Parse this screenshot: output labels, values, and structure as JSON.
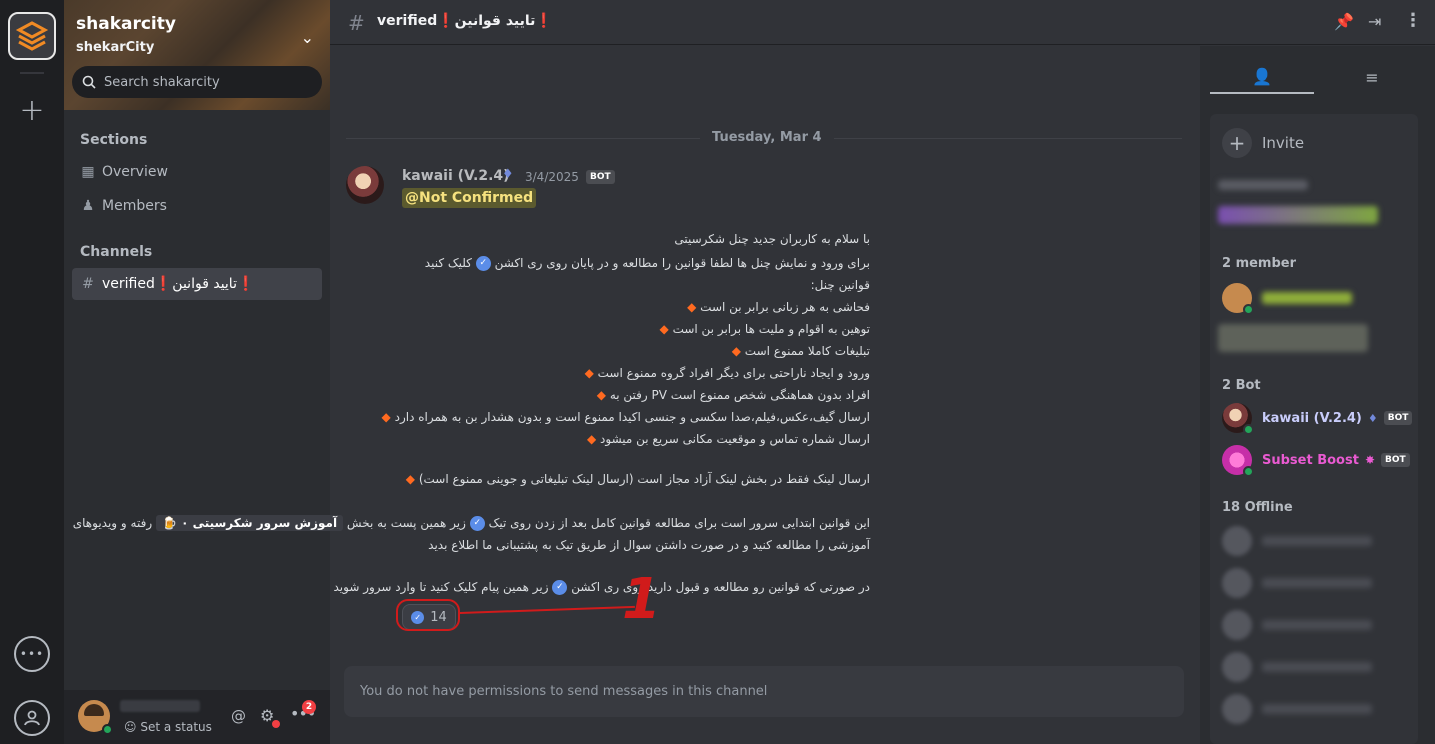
{
  "app": {
    "server_name": "shakarcity",
    "server_subtitle": "shekarCity",
    "search_placeholder": "Search shakarcity"
  },
  "sidebar": {
    "sections_header": "Sections",
    "sections": [
      {
        "label": "Overview",
        "icon": "grid-icon"
      },
      {
        "label": "Members",
        "icon": "members-icon"
      }
    ],
    "channels_header": "Channels",
    "channels": [
      {
        "label": "verified❗تایید قوانین❗",
        "icon": "hash-icon",
        "selected": true
      }
    ]
  },
  "user_panel": {
    "set_status": "Set a status",
    "notification_count": "2"
  },
  "header": {
    "channel_title": "verified❗تایید قوانین❗"
  },
  "chat": {
    "date_divider": "Tuesday, Mar 4",
    "message": {
      "author": "kawaii (V.2.4)",
      "date": "3/4/2025",
      "bot_tag": "BOT",
      "mention": "@Not Confirmed",
      "lines": [
        "با سلام به کاربران جدید چنل شکرسیتی",
        "برای ورود و نمایش چنل ها لطفا قوانین را مطالعه و در پایان روی ری اکشن",
        "کلیک کنید",
        "قوانین چنل:",
        "فحاشی به هر زبانی برابر بن است",
        "توهین به اقوام و ملیت ها برابر بن است",
        "تبلیغات کاملا ممنوع است",
        "ورود و ایجاد ناراحتی برای دیگر افراد گروه ممنوع است",
        "افراد بدون هماهنگی شخص ممنوع است PV رفتن به",
        "ارسال گیف،عکس،فیلم،صدا سکسی و جنسی اکیدا ممنوع است و بدون هشدار بن به همراه دارد",
        "ارسال شماره تماس و موقعیت مکانی سریع بن میشود",
        "ارسال لینک فقط در بخش لینک آزاد مجاز است (ارسال لینک تبلیغاتی و جوینی ممنوع است)",
        "این قوانین ابتدایی سرور است برای مطالعه قوانین کامل بعد از زدن روی تیک",
        "زیر همین پست به بخش",
        "آموزش سرور شکرسیتی ۰",
        "رفته و ویدیوهای",
        "آموزشی را مطالعه کنید و در صورت داشتن سوال از طریق تیک به پشتیبانی ما اطلاع بدید",
        "در صورتی که قوانین رو مطالعه و قبول دارید روی ری اکشن",
        "زیر همین پیام کلیک کنید تا وارد سرور شوید"
      ],
      "reaction_count": "14"
    },
    "annotation_number": "1",
    "no_permission": "You do not have permissions to send messages in this channel"
  },
  "members": {
    "invite_label": "Invite",
    "group_member": "2 member",
    "group_bot": "2 Bot",
    "group_offline": "18 Offline",
    "bots": [
      {
        "name": "kawaii (V.2.4)",
        "tag": "BOT",
        "color": "#c9cdfb"
      },
      {
        "name": "Subset Boost",
        "tag": "BOT",
        "color": "#e95ad1"
      }
    ]
  },
  "colors": {
    "accent_red": "#d11b1b",
    "online": "#23a55a",
    "mention_bg": "#5b5a2e",
    "boost": "#e95ad1"
  }
}
